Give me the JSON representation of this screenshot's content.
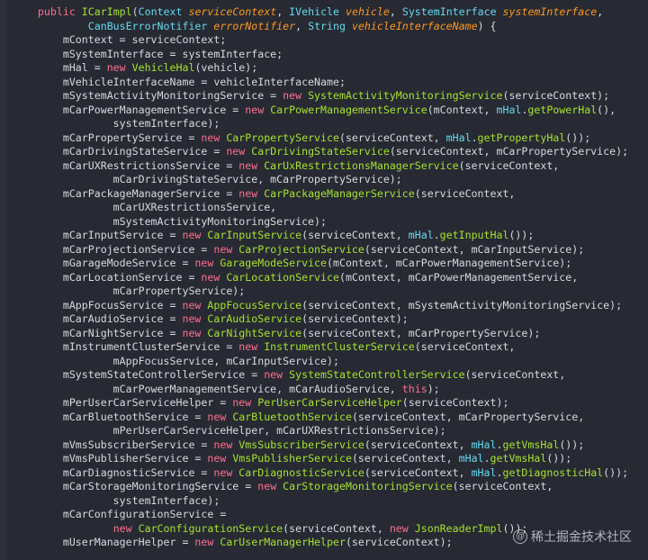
{
  "code_lines": [
    [
      [
        "plain",
        "    "
      ],
      [
        "kw",
        "public "
      ],
      [
        "cls",
        "ICarImpl"
      ],
      [
        "plain",
        "("
      ],
      [
        "type",
        "Context "
      ],
      [
        "par",
        "serviceContext"
      ],
      [
        "plain",
        ", "
      ],
      [
        "type",
        "IVehicle "
      ],
      [
        "par",
        "vehicle"
      ],
      [
        "plain",
        ", "
      ],
      [
        "type",
        "SystemInterface "
      ],
      [
        "par",
        "systemInterface"
      ],
      [
        "plain",
        ","
      ]
    ],
    [
      [
        "plain",
        "            "
      ],
      [
        "type",
        "CanBusErrorNotifier "
      ],
      [
        "par",
        "errorNotifier"
      ],
      [
        "plain",
        ", "
      ],
      [
        "type",
        "String "
      ],
      [
        "par",
        "vehicleInterfaceName"
      ],
      [
        "plain",
        ") {"
      ]
    ],
    [
      [
        "plain",
        "        mContext = serviceContext;"
      ]
    ],
    [
      [
        "plain",
        "        mSystemInterface = systemInterface;"
      ]
    ],
    [
      [
        "plain",
        "        mHal = "
      ],
      [
        "kw",
        "new "
      ],
      [
        "cls",
        "VehicleHal"
      ],
      [
        "plain",
        "(vehicle);"
      ]
    ],
    [
      [
        "plain",
        "        mVehicleInterfaceName = vehicleInterfaceName;"
      ]
    ],
    [
      [
        "plain",
        "        mSystemActivityMonitoringService = "
      ],
      [
        "kw",
        "new "
      ],
      [
        "cls",
        "SystemActivityMonitoringService"
      ],
      [
        "plain",
        "(serviceContext);"
      ]
    ],
    [
      [
        "plain",
        "        mCarPowerManagementService = "
      ],
      [
        "kw",
        "new "
      ],
      [
        "cls",
        "CarPowerManagementService"
      ],
      [
        "plain",
        "(mContext, "
      ],
      [
        "field",
        "mHal"
      ],
      [
        "plain",
        "."
      ],
      [
        "cls",
        "getPowerHal"
      ],
      [
        "plain",
        "(),"
      ]
    ],
    [
      [
        "plain",
        "                systemInterface);"
      ]
    ],
    [
      [
        "plain",
        "        mCarPropertyService = "
      ],
      [
        "kw",
        "new "
      ],
      [
        "cls",
        "CarPropertyService"
      ],
      [
        "plain",
        "(serviceContext, "
      ],
      [
        "field",
        "mHal"
      ],
      [
        "plain",
        "."
      ],
      [
        "cls",
        "getPropertyHal"
      ],
      [
        "plain",
        "());"
      ]
    ],
    [
      [
        "plain",
        "        mCarDrivingStateService = "
      ],
      [
        "kw",
        "new "
      ],
      [
        "cls",
        "CarDrivingStateService"
      ],
      [
        "plain",
        "(serviceContext, mCarPropertyService);"
      ]
    ],
    [
      [
        "plain",
        "        mCarUXRestrictionsService = "
      ],
      [
        "kw",
        "new "
      ],
      [
        "cls",
        "CarUxRestrictionsManagerService"
      ],
      [
        "plain",
        "(serviceContext,"
      ]
    ],
    [
      [
        "plain",
        "                mCarDrivingStateService, mCarPropertyService);"
      ]
    ],
    [
      [
        "plain",
        "        mCarPackageManagerService = "
      ],
      [
        "kw",
        "new "
      ],
      [
        "cls",
        "CarPackageManagerService"
      ],
      [
        "plain",
        "(serviceContext,"
      ]
    ],
    [
      [
        "plain",
        "                mCarUXRestrictionsService,"
      ]
    ],
    [
      [
        "plain",
        "                mSystemActivityMonitoringService);"
      ]
    ],
    [
      [
        "plain",
        "        mCarInputService = "
      ],
      [
        "kw",
        "new "
      ],
      [
        "cls",
        "CarInputService"
      ],
      [
        "plain",
        "(serviceContext, "
      ],
      [
        "field",
        "mHal"
      ],
      [
        "plain",
        "."
      ],
      [
        "cls",
        "getInputHal"
      ],
      [
        "plain",
        "());"
      ]
    ],
    [
      [
        "plain",
        "        mCarProjectionService = "
      ],
      [
        "kw",
        "new "
      ],
      [
        "cls",
        "CarProjectionService"
      ],
      [
        "plain",
        "(serviceContext, mCarInputService);"
      ]
    ],
    [
      [
        "plain",
        "        mGarageModeService = "
      ],
      [
        "kw",
        "new "
      ],
      [
        "cls",
        "GarageModeService"
      ],
      [
        "plain",
        "(mContext, mCarPowerManagementService);"
      ]
    ],
    [
      [
        "plain",
        "        mCarLocationService = "
      ],
      [
        "kw",
        "new "
      ],
      [
        "cls",
        "CarLocationService"
      ],
      [
        "plain",
        "(mContext, mCarPowerManagementService,"
      ]
    ],
    [
      [
        "plain",
        "                mCarPropertyService);"
      ]
    ],
    [
      [
        "plain",
        "        mAppFocusService = "
      ],
      [
        "kw",
        "new "
      ],
      [
        "cls",
        "AppFocusService"
      ],
      [
        "plain",
        "(serviceContext, mSystemActivityMonitoringService);"
      ]
    ],
    [
      [
        "plain",
        "        mCarAudioService = "
      ],
      [
        "kw",
        "new "
      ],
      [
        "cls",
        "CarAudioService"
      ],
      [
        "plain",
        "(serviceContext);"
      ]
    ],
    [
      [
        "plain",
        "        mCarNightService = "
      ],
      [
        "kw",
        "new "
      ],
      [
        "cls",
        "CarNightService"
      ],
      [
        "plain",
        "(serviceContext, mCarPropertyService);"
      ]
    ],
    [
      [
        "plain",
        "        mInstrumentClusterService = "
      ],
      [
        "kw",
        "new "
      ],
      [
        "cls",
        "InstrumentClusterService"
      ],
      [
        "plain",
        "(serviceContext,"
      ]
    ],
    [
      [
        "plain",
        "                mAppFocusService, mCarInputService);"
      ]
    ],
    [
      [
        "plain",
        "        mSystemStateControllerService = "
      ],
      [
        "kw",
        "new "
      ],
      [
        "cls",
        "SystemStateControllerService"
      ],
      [
        "plain",
        "(serviceContext,"
      ]
    ],
    [
      [
        "plain",
        "                mCarPowerManagementService, mCarAudioService, "
      ],
      [
        "kw",
        "this"
      ],
      [
        "plain",
        ");"
      ]
    ],
    [
      [
        "plain",
        "        mPerUserCarServiceHelper = "
      ],
      [
        "kw",
        "new "
      ],
      [
        "cls",
        "PerUserCarServiceHelper"
      ],
      [
        "plain",
        "(serviceContext);"
      ]
    ],
    [
      [
        "plain",
        "        mCarBluetoothService = "
      ],
      [
        "kw",
        "new "
      ],
      [
        "cls",
        "CarBluetoothService"
      ],
      [
        "plain",
        "(serviceContext, mCarPropertyService,"
      ]
    ],
    [
      [
        "plain",
        "                mPerUserCarServiceHelper, mCarUXRestrictionsService);"
      ]
    ],
    [
      [
        "plain",
        "        mVmsSubscriberService = "
      ],
      [
        "kw",
        "new "
      ],
      [
        "cls",
        "VmsSubscriberService"
      ],
      [
        "plain",
        "(serviceContext, "
      ],
      [
        "field",
        "mHal"
      ],
      [
        "plain",
        "."
      ],
      [
        "cls",
        "getVmsHal"
      ],
      [
        "plain",
        "());"
      ]
    ],
    [
      [
        "plain",
        "        mVmsPublisherService = "
      ],
      [
        "kw",
        "new "
      ],
      [
        "cls",
        "VmsPublisherService"
      ],
      [
        "plain",
        "(serviceContext, "
      ],
      [
        "field",
        "mHal"
      ],
      [
        "plain",
        "."
      ],
      [
        "cls",
        "getVmsHal"
      ],
      [
        "plain",
        "());"
      ]
    ],
    [
      [
        "plain",
        "        mCarDiagnosticService = "
      ],
      [
        "kw",
        "new "
      ],
      [
        "cls",
        "CarDiagnosticService"
      ],
      [
        "plain",
        "(serviceContext, "
      ],
      [
        "field",
        "mHal"
      ],
      [
        "plain",
        "."
      ],
      [
        "cls",
        "getDiagnosticHal"
      ],
      [
        "plain",
        "());"
      ]
    ],
    [
      [
        "plain",
        "        mCarStorageMonitoringService = "
      ],
      [
        "kw",
        "new "
      ],
      [
        "cls",
        "CarStorageMonitoringService"
      ],
      [
        "plain",
        "(serviceContext,"
      ]
    ],
    [
      [
        "plain",
        "                systemInterface);"
      ]
    ],
    [
      [
        "plain",
        "        mCarConfigurationService ="
      ]
    ],
    [
      [
        "plain",
        "                "
      ],
      [
        "kw",
        "new "
      ],
      [
        "cls",
        "CarConfigurationService"
      ],
      [
        "plain",
        "(serviceContext, "
      ],
      [
        "kw",
        "new "
      ],
      [
        "cls",
        "JsonReaderImpl"
      ],
      [
        "plain",
        "());"
      ]
    ],
    [
      [
        "plain",
        "        mUserManagerHelper = "
      ],
      [
        "kw",
        "new "
      ],
      [
        "cls",
        "CarUserManagerHelper"
      ],
      [
        "plain",
        "(serviceContext);"
      ]
    ]
  ],
  "watermark": {
    "text": "稀土掘金技术社区",
    "icon": "juejin-logo-icon"
  },
  "colors": {
    "background": "#272A33",
    "keyword": "#FF6E8E",
    "type": "#66D9EF",
    "class": "#A6E22E",
    "param": "#FD971F",
    "text": "#D7DAE0"
  }
}
